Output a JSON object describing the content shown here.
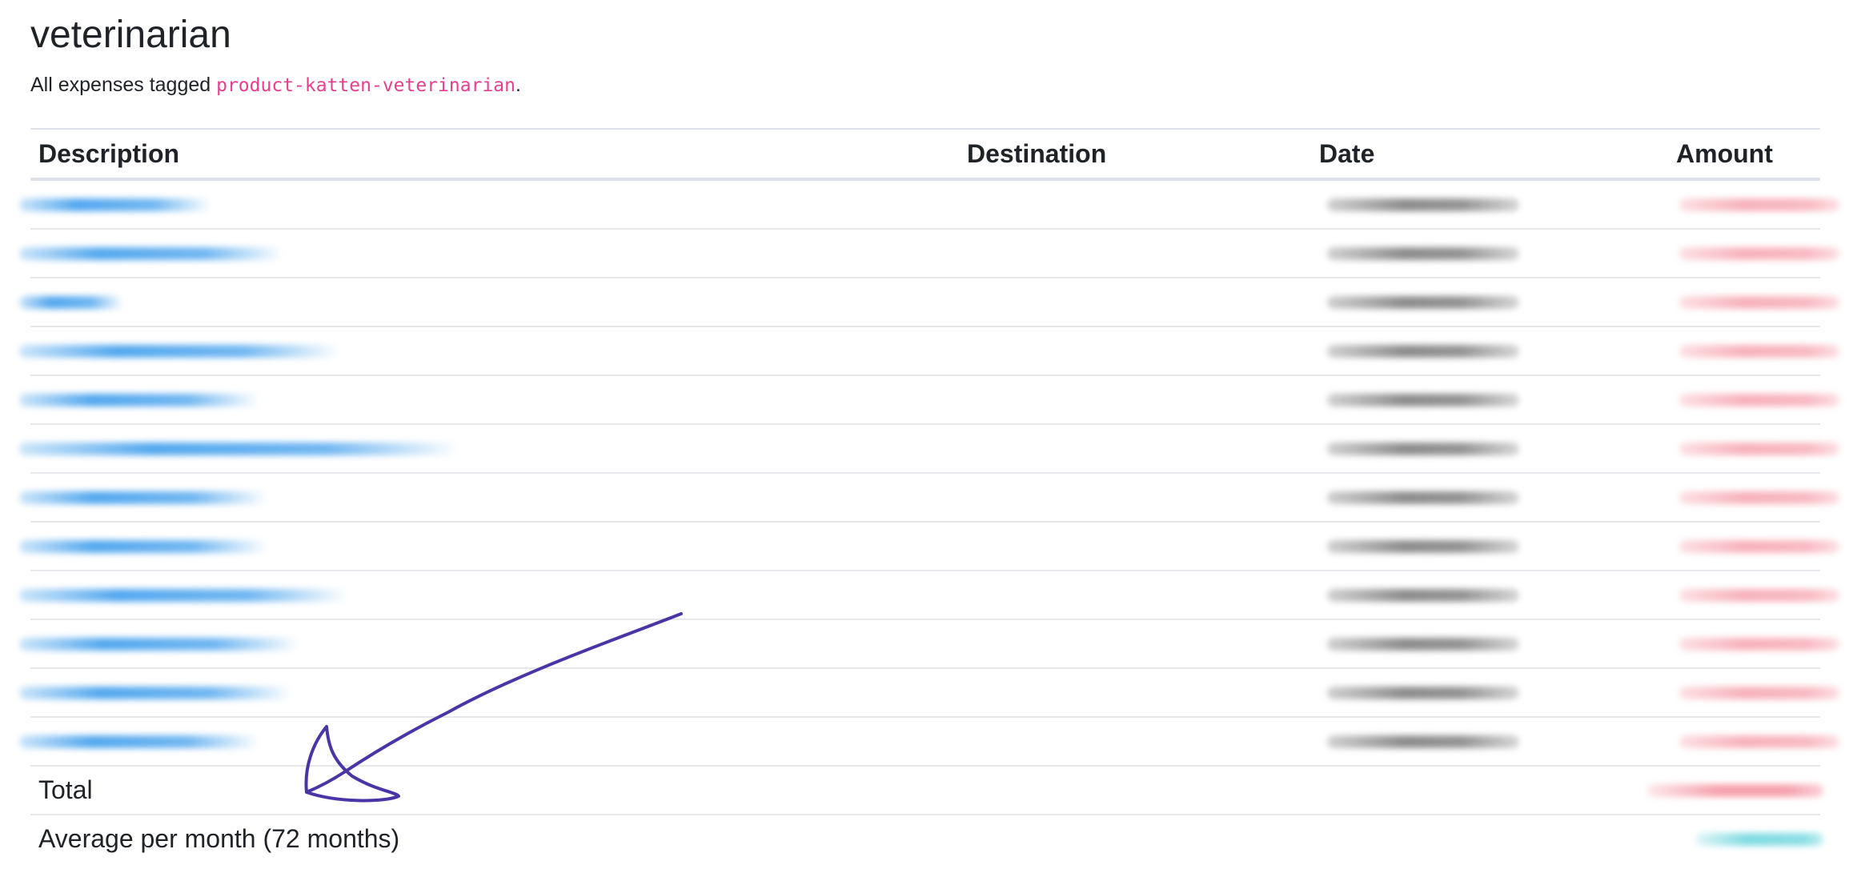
{
  "page": {
    "title": "veterinarian",
    "subtitle_prefix": "All expenses tagged ",
    "tag": "product-katten-veterinarian",
    "subtitle_suffix": "."
  },
  "table": {
    "headers": {
      "description": "Description",
      "destination": "Destination",
      "date": "Date",
      "amount": "Amount"
    },
    "footer": {
      "total_label": "Total",
      "average_label": "Average per month (72 months)"
    }
  },
  "annotation": {
    "color": "#4b35a6",
    "type": "hand-drawn-arrow"
  },
  "colors": {
    "tag": "#e83e8c",
    "description_redacted": "#3498eb",
    "amount_redacted": "#f06478",
    "average_redacted": "#3cc8d2"
  }
}
